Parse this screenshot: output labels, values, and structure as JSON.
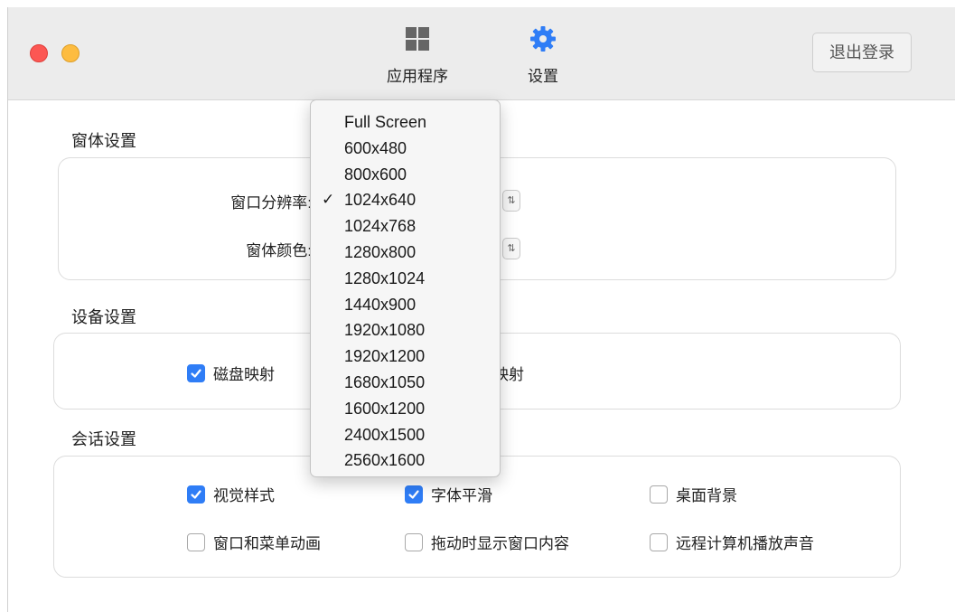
{
  "toolbar": {
    "apps_label": "应用程序",
    "settings_label": "设置",
    "logout_label": "退出登录"
  },
  "window_section": {
    "title": "窗体设置",
    "resolution_label": "窗口分辨率:",
    "color_label": "窗体颜色:"
  },
  "device_section": {
    "title": "设备设置",
    "disk_mapping_label": "磁盘映射",
    "disk_mapping_checked": true,
    "second_mapping_label_visible": "映射"
  },
  "session_section": {
    "title": "会话设置",
    "options": [
      {
        "label": "视觉样式",
        "checked": true
      },
      {
        "label": "字体平滑",
        "checked": true
      },
      {
        "label": "桌面背景",
        "checked": false
      },
      {
        "label": "窗口和菜单动画",
        "checked": false
      },
      {
        "label": "拖动时显示窗口内容",
        "checked": false
      },
      {
        "label": "远程计算机播放声音",
        "checked": false
      }
    ]
  },
  "resolution_dropdown": {
    "selected": "1024x640",
    "options": [
      "Full Screen",
      "600x480",
      "800x600",
      "1024x640",
      "1024x768",
      "1280x800",
      "1280x1024",
      "1440x900",
      "1920x1080",
      "1920x1200",
      "1680x1050",
      "1600x1200",
      "2400x1500",
      "2560x1600"
    ]
  },
  "colors": {
    "accent": "#2f7df6",
    "close": "#fc5753",
    "minimize": "#fdbc40",
    "toolbar_bg": "#ececec"
  }
}
